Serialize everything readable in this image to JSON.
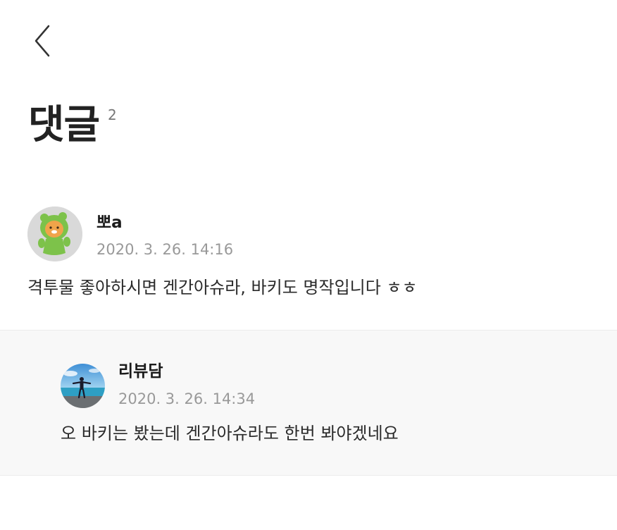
{
  "header": {
    "back_icon": "chevron-left-icon",
    "title": "댓글",
    "count": "2"
  },
  "comments": [
    {
      "author": "뽀a",
      "date": "2020. 3. 26. 14:16",
      "text": "격투물 좋아하시면 겐간아슈라, 바키도 명작입니다 ㅎㅎ",
      "avatar": "ryan-character-avatar"
    },
    {
      "author": "리뷰담",
      "date": "2020. 3. 26. 14:34",
      "text": "오 바키는 봤는데 겐간아슈라도 한번 봐야겠네요",
      "avatar": "beach-photo-avatar",
      "is_reply": true
    }
  ],
  "colors": {
    "background": "#ffffff",
    "reply_background": "#f8f8f8",
    "text_primary": "#222222",
    "text_secondary": "#999999",
    "divider": "#ececec"
  }
}
